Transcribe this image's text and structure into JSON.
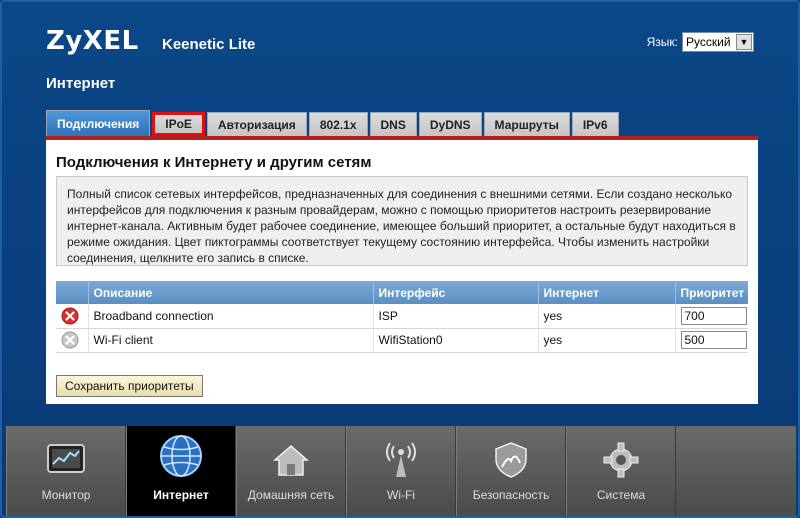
{
  "header": {
    "brand": "ZyXEL",
    "model": "Keenetic Lite",
    "language_label": "Язык:",
    "language_value": "Русский"
  },
  "section_title": "Интернет",
  "tabs": [
    {
      "label": "Подключения",
      "active": true
    },
    {
      "label": "IPoE",
      "highlighted": true
    },
    {
      "label": "Авторизация"
    },
    {
      "label": "802.1x"
    },
    {
      "label": "DNS"
    },
    {
      "label": "DyDNS"
    },
    {
      "label": "Маршруты"
    },
    {
      "label": "IPv6"
    }
  ],
  "panel": {
    "title": "Подключения к Интернету и другим сетям",
    "description": "Полный список сетевых интерфейсов, предназначенных для соединения с внешними сетями. Если создано несколько интерфейсов для подключения к разным провайдерам, можно с помощью приоритетов настроить резервирование интернет-канала. Активным будет рабочее соединение, имеющее больший приоритет, а остальные будут находиться в режиме ожидания. Цвет пиктограммы соответствует текущему состоянию интерфейса. Чтобы изменить настройки соединения, щелкните его запись в списке.",
    "columns": {
      "description": "Описание",
      "interface": "Интерфейс",
      "internet": "Интернет",
      "priority": "Приоритет"
    },
    "rows": [
      {
        "status": "error",
        "description": "Broadband connection",
        "interface": "ISP",
        "internet": "yes",
        "priority": "700"
      },
      {
        "status": "inactive",
        "description": "Wi-Fi client",
        "interface": "WifiStation0",
        "internet": "yes",
        "priority": "500"
      }
    ],
    "save_label": "Сохранить приоритеты"
  },
  "bottom_nav": [
    {
      "label": "Монитор",
      "icon": "monitor-icon"
    },
    {
      "label": "Интернет",
      "icon": "globe-icon",
      "active": true
    },
    {
      "label": "Домашняя сеть",
      "icon": "home-icon"
    },
    {
      "label": "Wi-Fi",
      "icon": "wifi-antenna-icon"
    },
    {
      "label": "Безопасность",
      "icon": "shield-icon"
    },
    {
      "label": "Система",
      "icon": "gear-icon"
    }
  ],
  "colors": {
    "accent_red": "#b32020",
    "header_blue": "#0a3f7d",
    "tab_active": "#3a82c6"
  }
}
